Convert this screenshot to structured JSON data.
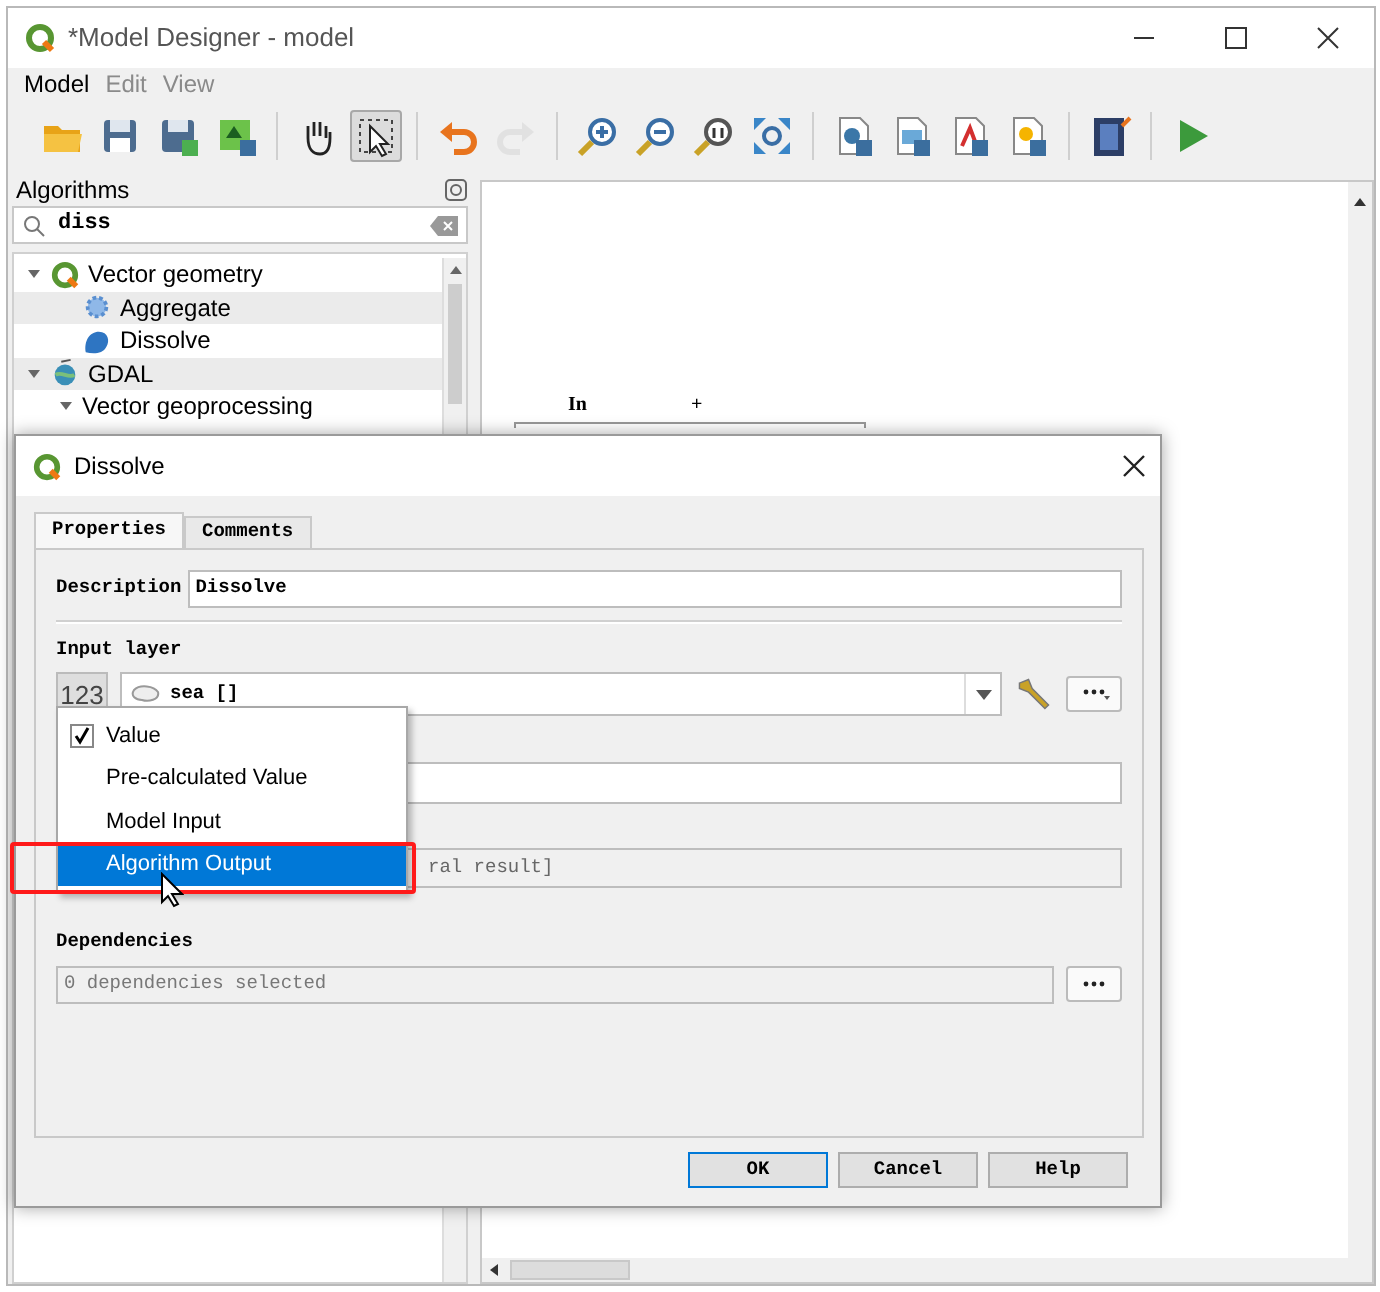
{
  "window": {
    "title": "*Model Designer - model"
  },
  "menu": [
    {
      "label": "Model",
      "disabled": false
    },
    {
      "label": "Edit",
      "disabled": true
    },
    {
      "label": "View",
      "disabled": true
    }
  ],
  "toolbar": [
    [
      {
        "kind": "open",
        "selected": false,
        "disabled": false
      },
      {
        "kind": "save",
        "selected": false,
        "disabled": false
      },
      {
        "kind": "saveas",
        "selected": false,
        "disabled": false
      },
      {
        "kind": "export",
        "selected": false,
        "disabled": false
      }
    ],
    [
      {
        "kind": "pan",
        "selected": false,
        "disabled": false
      },
      {
        "kind": "select",
        "selected": true,
        "disabled": false
      }
    ],
    [
      {
        "kind": "undo",
        "selected": false,
        "disabled": false
      },
      {
        "kind": "redo",
        "selected": false,
        "disabled": true
      }
    ],
    [
      {
        "kind": "zoomin",
        "selected": false,
        "disabled": false
      },
      {
        "kind": "zoomout",
        "selected": false,
        "disabled": false
      },
      {
        "kind": "zoomactual",
        "selected": false,
        "disabled": false
      },
      {
        "kind": "zoomfull",
        "selected": false,
        "disabled": false
      }
    ],
    [
      {
        "kind": "python",
        "selected": false,
        "disabled": false
      },
      {
        "kind": "image",
        "selected": false,
        "disabled": false
      },
      {
        "kind": "pdf",
        "selected": false,
        "disabled": false
      },
      {
        "kind": "svg",
        "selected": false,
        "disabled": false
      }
    ],
    [
      {
        "kind": "help",
        "selected": false,
        "disabled": false
      }
    ],
    [
      {
        "kind": "run",
        "selected": false,
        "disabled": false
      }
    ]
  ],
  "algorithms": {
    "title": "Algorithms",
    "search": {
      "value": "diss"
    },
    "tree": [
      {
        "label": "Vector geometry",
        "kind": "logo",
        "expanded": true,
        "children": [
          {
            "label": "Aggregate",
            "kind": "gear"
          },
          {
            "label": "Dissolve",
            "kind": "blob"
          }
        ]
      },
      {
        "label": "GDAL",
        "kind": "globe",
        "expanded": true,
        "children": [
          {
            "label": "Vector geoprocessing",
            "kind": "group",
            "expanded": true
          }
        ]
      }
    ]
  },
  "canvas": {
    "texts": [
      "In",
      "+"
    ]
  },
  "dialog": {
    "title": "Dissolve",
    "tabs": [
      {
        "label": "Properties",
        "selected": true
      },
      {
        "label": "Comments",
        "selected": false
      }
    ],
    "description": {
      "label": "Description",
      "value": "Dissolve"
    },
    "input_layer": {
      "label": "Input layer",
      "source_button": "123",
      "value": "sea []"
    },
    "source_menu": [
      {
        "label": "Value",
        "checked": true,
        "selected": false
      },
      {
        "label": "Pre-calculated Value",
        "checked": false,
        "selected": false
      },
      {
        "label": "Model Input",
        "checked": false,
        "selected": false
      },
      {
        "label": "Algorithm Output",
        "checked": false,
        "selected": true
      }
    ],
    "output_field": {
      "value": "ral result]"
    },
    "dependencies": {
      "label": "Dependencies",
      "value": "0 dependencies selected",
      "disabled": true
    },
    "buttons": [
      {
        "label": "OK",
        "default": true
      },
      {
        "label": "Cancel",
        "default": false
      },
      {
        "label": "Help",
        "default": false
      }
    ]
  }
}
